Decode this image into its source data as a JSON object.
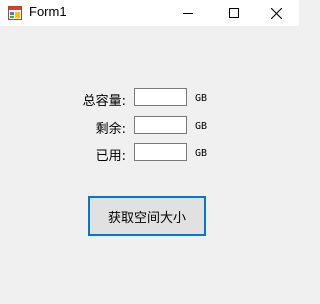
{
  "window": {
    "title": "Form1"
  },
  "form": {
    "fields": [
      {
        "label": "总容量:",
        "value": "",
        "unit": "GB"
      },
      {
        "label": "剩余:",
        "value": "",
        "unit": "GB"
      },
      {
        "label": "已用:",
        "value": "",
        "unit": "GB"
      }
    ],
    "action_label": "获取空间大小"
  }
}
